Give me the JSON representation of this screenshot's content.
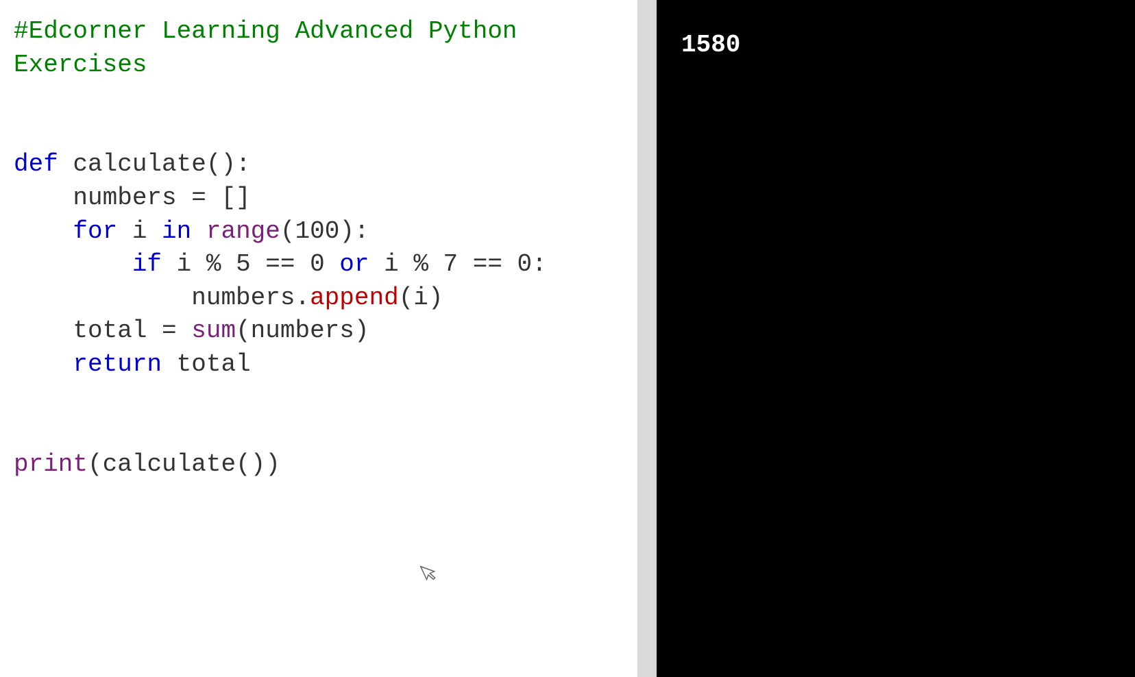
{
  "editor": {
    "comment": "#Edcorner Learning Advanced Python\nExercises",
    "kw_def": "def",
    "fn_name": " calculate():",
    "l_numbers_eq": "    numbers = []",
    "kw_for": "    for",
    "l_for_mid": " i ",
    "kw_in": "in",
    "l_sp": " ",
    "fn_range": "range",
    "l_range_args": "(100):",
    "kw_if": "        if",
    "l_if_lhs": " i % 5 == 0 ",
    "kw_or": "or",
    "l_if_rhs": " i % 7 == 0:",
    "l_append_pre": "            numbers.",
    "fn_append": "append",
    "l_append_args": "(i)",
    "l_total_pre": "    total = ",
    "fn_sum": "sum",
    "l_total_args": "(numbers)",
    "kw_return": "    return",
    "l_return_val": " total",
    "fn_print": "print",
    "l_print_args": "(calculate())"
  },
  "output": {
    "result": "1580"
  }
}
